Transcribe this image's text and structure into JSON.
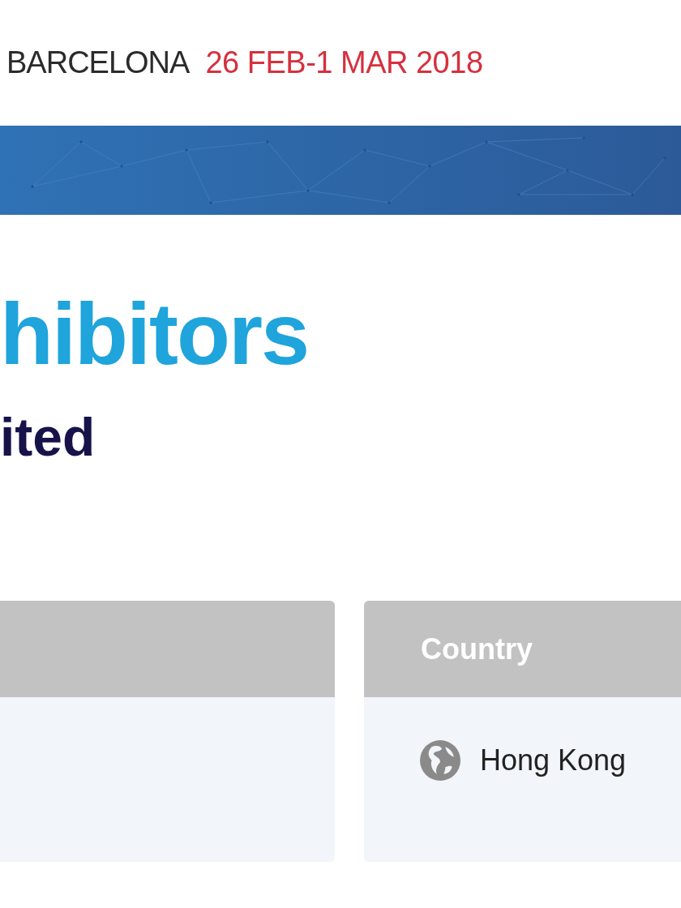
{
  "header": {
    "city": "BARCELONA",
    "dates": "26 FEB-1 MAR 2018"
  },
  "title": "hibitors",
  "subtitle": "ited",
  "country_card": {
    "heading": "Country",
    "value": "Hong Kong"
  }
}
